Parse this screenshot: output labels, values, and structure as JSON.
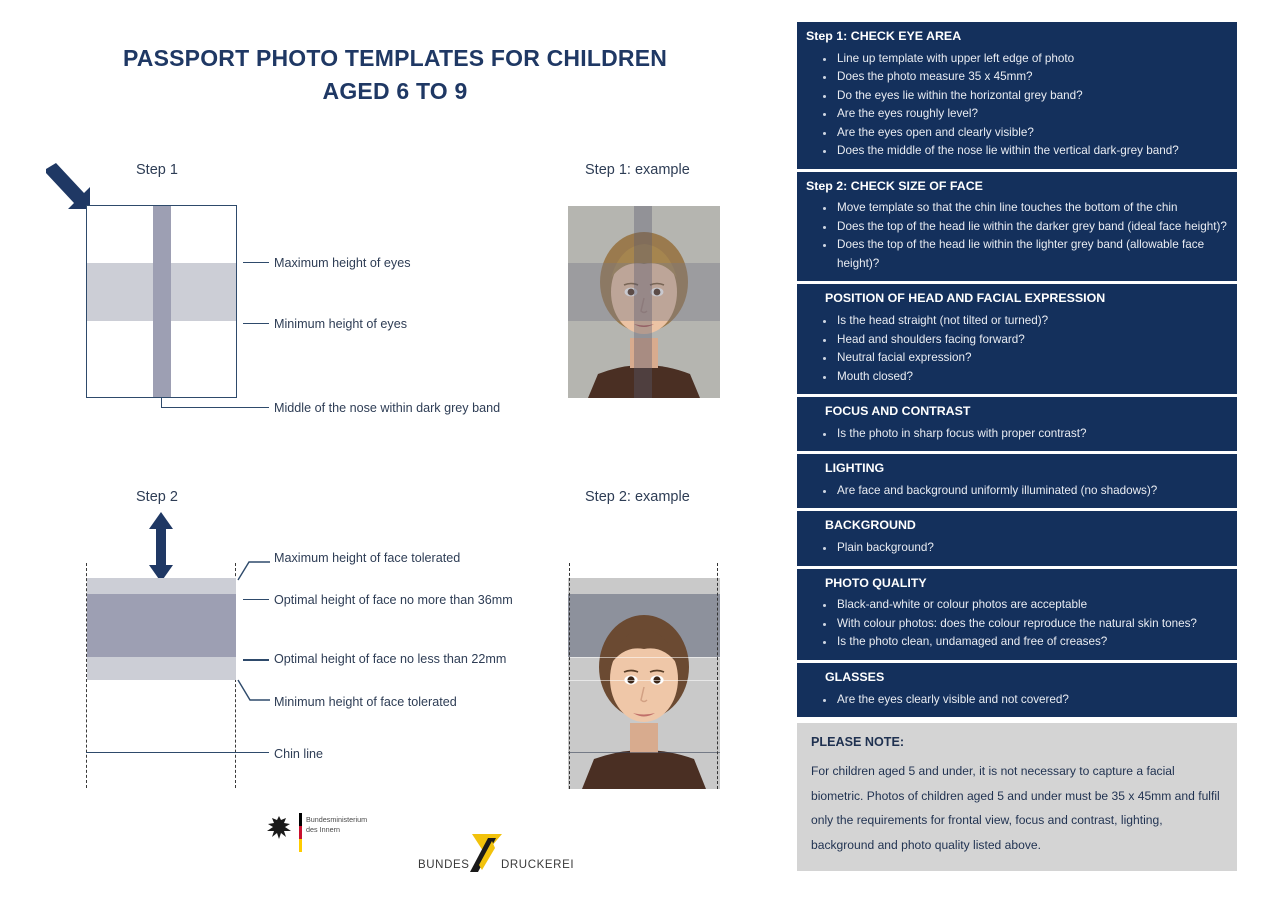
{
  "title": {
    "line1": "PASSPORT PHOTO TEMPLATES FOR CHILDREN",
    "line2": "AGED 6 TO 9"
  },
  "diagrams": {
    "step1": {
      "caption": "Step 1",
      "example_caption": "Step 1: example",
      "labels": [
        "Maximum height of eyes",
        "Minimum height of eyes",
        "Middle of the nose within dark grey band"
      ]
    },
    "step2": {
      "caption": "Step 2",
      "example_caption": "Step 2: example",
      "labels": [
        "Maximum height of face tolerated",
        "Optimal height of face no more than 36mm",
        "Optimal height of face no less than 22mm",
        "Minimum height of face tolerated",
        "Chin line"
      ]
    }
  },
  "checklist": [
    {
      "heading": "Step 1: CHECK EYE AREA",
      "indent": false,
      "items": [
        "Line up template with upper left edge of photo",
        "Does the photo measure 35 x 45mm?",
        "Do the eyes lie within the horizontal grey band?",
        "Are the eyes roughly  level?",
        "Are the eyes open and clearly visible?",
        "Does the middle of the nose lie within the vertical dark-grey band?"
      ]
    },
    {
      "heading": "Step 2: CHECK SIZE OF FACE",
      "indent": false,
      "items": [
        "Move template so that the chin line touches the bottom of the chin",
        "Does the top of the head lie within the darker grey band (ideal face height)?",
        "Does the top of the head lie within the lighter grey band (allowable face height)?"
      ]
    },
    {
      "heading": "POSITION OF HEAD AND FACIAL EXPRESSION",
      "indent": true,
      "items": [
        "Is the head straight (not tilted or turned)?",
        "Head and shoulders facing  forward?",
        "Neutral facial expression?",
        "Mouth closed?"
      ]
    },
    {
      "heading": "FOCUS AND CONTRAST",
      "indent": true,
      "items": [
        "Is the photo in sharp focus with proper contrast?"
      ]
    },
    {
      "heading": "LIGHTING",
      "indent": true,
      "items": [
        "Are face and background uniformly illuminated (no shadows)?"
      ]
    },
    {
      "heading": "BACKGROUND",
      "indent": true,
      "items": [
        "Plain background?"
      ]
    },
    {
      "heading": "PHOTO QUALITY",
      "indent": true,
      "items": [
        "Black-and-white or colour photos are  acceptable",
        "With colour photos: does the colour reproduce the natural skin tones?",
        "Is the photo clean, undamaged and free of  creases?"
      ]
    },
    {
      "heading": "GLASSES",
      "indent": true,
      "items": [
        "Are the eyes clearly visible and not covered?"
      ]
    }
  ],
  "note": {
    "heading": "PLEASE NOTE:",
    "body": "For children aged 5 and under, it is not necessary to capture a facial biometric. Photos of children aged 5 and under must be 35 x 45mm and fulfil only the requirements for frontal view, focus and contrast, lighting, background and photo quality listed above."
  },
  "footer": {
    "ministry_line1": "Bundesministerium",
    "ministry_line2": "des Innern",
    "printer_left": "BUNDES",
    "printer_right": "DRUCKEREI"
  },
  "colors": {
    "navy": "#14305c",
    "title_navy": "#1f3864",
    "band_light": "#ccced6",
    "band_dark": "#9d9fb3",
    "note_bg": "#d4d4d4",
    "flag_black": "#000000",
    "flag_red": "#c8102e",
    "flag_gold": "#ffcc00",
    "bdr_yellow": "#f2c20b"
  }
}
